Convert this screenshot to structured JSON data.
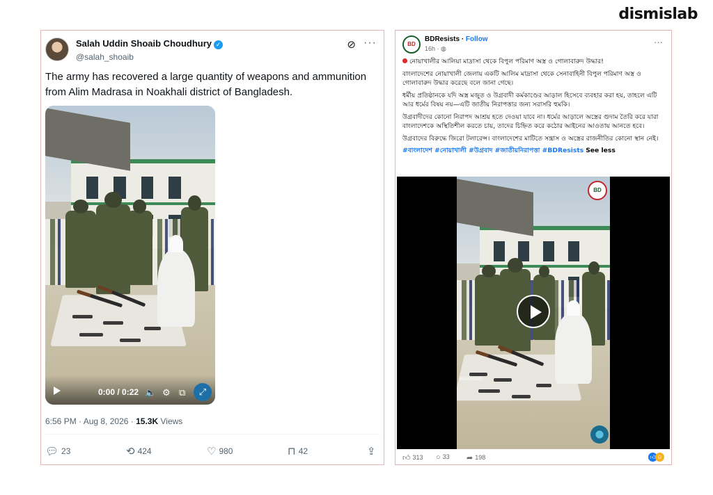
{
  "brand": "dismislab",
  "tweet": {
    "author_name": "Salah Uddin Shoaib Choudhury",
    "author_handle": "@salah_shoaib",
    "verified_mark": "✓",
    "grok_icon": "⊘",
    "more_icon": "···",
    "text": "The army has recovered a large quantity of weapons and ammunition from Alim Madrasa in Noakhali district of Bangladesh.",
    "video_time": "0:00 / 0:22",
    "posted_time": "6:56 PM · Aug 8, 2026",
    "views_count": "15.3K",
    "views_label": "Views",
    "replies": "23",
    "reposts": "424",
    "likes": "980",
    "bookmarks": "42",
    "icons": [
      "reply-icon",
      "repost-icon",
      "like-icon",
      "bookmark-icon",
      "share-icon"
    ]
  },
  "fb": {
    "page_name": "BDResists",
    "follow_label": "Follow",
    "time": "16h · ◍",
    "more_icon": "···",
    "logo_text": "BD",
    "p1": "নোয়াখালীর আলিয়া মাদ্রাসা থেকে বিপুল পরিমাণ অস্ত্র ও গোলাবারুদ উদ্ধার!",
    "p2": "বাংলাদেশের নোয়াখালী জেলায় একটি আলিম মাদ্রাসা থেকে সেনাবাহিনী বিপুল পরিমাণ অস্ত্র ও গোলাবারুদ উদ্ধার করেছে বলে জানা গেছে।",
    "p3": "ধর্মীয় প্রতিষ্ঠানকে যদি অস্ত্র মজুত ও উগ্রবাদী কর্মকাণ্ডের আড়াল হিসেবে ব্যবহার করা হয়, তাহলে এটি আর ধর্মের বিষয় নয়—এটি জাতীয় নিরাপত্তার জন্য সরাসরি হুমকি।",
    "p4": "উগ্রবাদীদের কোনো নিরাপদ আশ্রয় হতে দেওয়া যাবে না। ধর্মের আড়ালে অস্ত্রের গুদাম তৈরি করে যারা বাংলাদেশকে অস্থিতিশীল করতে চায়, তাদের চিহ্নিত করে কঠোর আইনের আওতায় আনতে হবে।",
    "p5": "উগ্রবাদের বিরুদ্ধে জিরো টলারেন্স। বাংলাদেশের মাটিতে সন্ত্রাস ও অস্ত্রের রাজনীতির কোনো স্থান নেই।",
    "hashtags": "#বাংলাদেশ #নোয়াখালী #উগ্রবাদ #জাতীয়নিরাপত্তা #BDResists",
    "see_less": "See less",
    "watermark": "BDResists",
    "likes": "313",
    "comments": "33",
    "shares": "198"
  },
  "colors": {
    "accent_blue": "#1d9bf0",
    "fb_blue": "#1877f2",
    "card_border": "#e3b4b4",
    "army_green": "#3c8a56"
  }
}
